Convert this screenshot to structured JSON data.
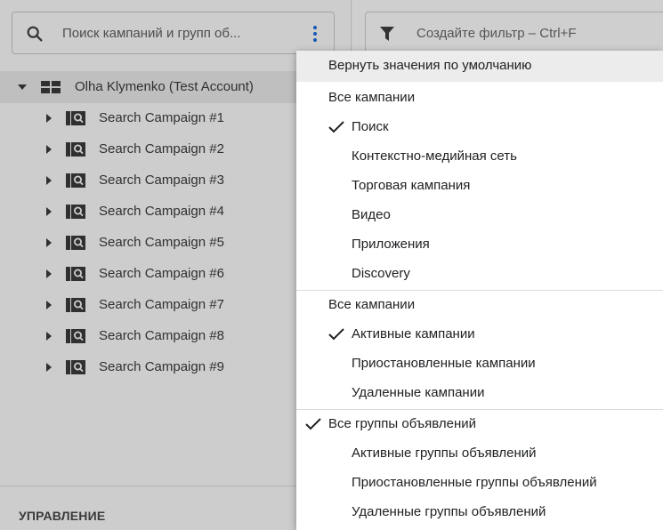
{
  "search": {
    "placeholder": "Поиск кампаний и групп об...",
    "icon": "search-icon"
  },
  "more_button": {
    "icon": "more-vert-icon",
    "color": "#1558b6"
  },
  "filter": {
    "placeholder": "Создайте фильтр – Ctrl+F",
    "icon": "filter-icon"
  },
  "tree": {
    "account": {
      "label": "Olha Klymenko (Test Account)",
      "expanded": true
    },
    "campaigns": [
      {
        "label": "Search Campaign #1"
      },
      {
        "label": "Search Campaign #2"
      },
      {
        "label": "Search Campaign #3"
      },
      {
        "label": "Search Campaign #4"
      },
      {
        "label": "Search Campaign #5"
      },
      {
        "label": "Search Campaign #6"
      },
      {
        "label": "Search Campaign #7"
      },
      {
        "label": "Search Campaign #8"
      },
      {
        "label": "Search Campaign #9"
      }
    ]
  },
  "section_label": "УПРАВЛЕНИЕ",
  "menu": {
    "reset_label": "Вернуть значения по умолчанию",
    "type_group": {
      "all_label": "Все кампании",
      "items": [
        {
          "label": "Поиск",
          "checked": true
        },
        {
          "label": "Контекстно-медийная сеть",
          "checked": false
        },
        {
          "label": "Торговая кампания",
          "checked": false
        },
        {
          "label": "Видео",
          "checked": false
        },
        {
          "label": "Приложения",
          "checked": false
        },
        {
          "label": "Discovery",
          "checked": false
        }
      ]
    },
    "status_group": {
      "all_label": "Все кампании",
      "items": [
        {
          "label": "Активные кампании",
          "checked": true
        },
        {
          "label": "Приостановленные кампании",
          "checked": false
        },
        {
          "label": "Удаленные кампании",
          "checked": false
        }
      ]
    },
    "adgroup_group": {
      "all_label": "Все группы объявлений",
      "all_checked": true,
      "items": [
        {
          "label": "Активные группы объявлений",
          "checked": false
        },
        {
          "label": "Приостановленные группы объявлений",
          "checked": false
        },
        {
          "label": "Удаленные группы объявлений",
          "checked": false
        }
      ]
    }
  }
}
